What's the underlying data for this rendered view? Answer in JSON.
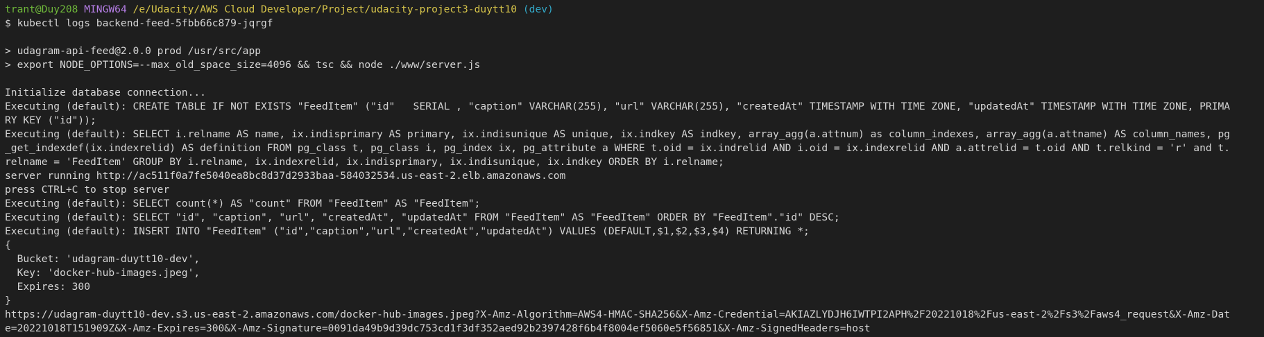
{
  "prompt": {
    "user_host": "trant@Duy208",
    "shell": "MINGW64",
    "path": "/e/Udacity/AWS Cloud Developer/Project/udacity-project3-duytt10",
    "branch": "(dev)"
  },
  "command": "$ kubectl logs backend-feed-5fbb66c879-jqrgf",
  "output_lines": [
    "",
    "> udagram-api-feed@2.0.0 prod /usr/src/app",
    "> export NODE_OPTIONS=--max_old_space_size=4096 && tsc && node ./www/server.js",
    "",
    "Initialize database connection...",
    "Executing (default): CREATE TABLE IF NOT EXISTS \"FeedItem\" (\"id\"   SERIAL , \"caption\" VARCHAR(255), \"url\" VARCHAR(255), \"createdAt\" TIMESTAMP WITH TIME ZONE, \"updatedAt\" TIMESTAMP WITH TIME ZONE, PRIMA",
    "RY KEY (\"id\"));",
    "Executing (default): SELECT i.relname AS name, ix.indisprimary AS primary, ix.indisunique AS unique, ix.indkey AS indkey, array_agg(a.attnum) as column_indexes, array_agg(a.attname) AS column_names, pg",
    "_get_indexdef(ix.indexrelid) AS definition FROM pg_class t, pg_class i, pg_index ix, pg_attribute a WHERE t.oid = ix.indrelid AND i.oid = ix.indexrelid AND a.attrelid = t.oid AND t.relkind = 'r' and t.",
    "relname = 'FeedItem' GROUP BY i.relname, ix.indexrelid, ix.indisprimary, ix.indisunique, ix.indkey ORDER BY i.relname;",
    "server running http://ac511f0a7fe5040ea8bc8d37d2933baa-584032534.us-east-2.elb.amazonaws.com",
    "press CTRL+C to stop server",
    "Executing (default): SELECT count(*) AS \"count\" FROM \"FeedItem\" AS \"FeedItem\";",
    "Executing (default): SELECT \"id\", \"caption\", \"url\", \"createdAt\", \"updatedAt\" FROM \"FeedItem\" AS \"FeedItem\" ORDER BY \"FeedItem\".\"id\" DESC;",
    "Executing (default): INSERT INTO \"FeedItem\" (\"id\",\"caption\",\"url\",\"createdAt\",\"updatedAt\") VALUES (DEFAULT,$1,$2,$3,$4) RETURNING *;",
    "{",
    "  Bucket: 'udagram-duytt10-dev',",
    "  Key: 'docker-hub-images.jpeg',",
    "  Expires: 300",
    "}",
    "https://udagram-duytt10-dev.s3.us-east-2.amazonaws.com/docker-hub-images.jpeg?X-Amz-Algorithm=AWS4-HMAC-SHA256&X-Amz-Credential=AKIAZLYDJH6IWTPI2APH%2F20221018%2Fus-east-2%2Fs3%2Faws4_request&X-Amz-Dat",
    "e=20221018T151909Z&X-Amz-Expires=300&X-Amz-Signature=0091da49b9d39dc753cd1f3df352aed92b2397428f6b4f8004ef5060e5f56851&X-Amz-SignedHeaders=host"
  ],
  "colors": {
    "background": "#1e1e1e",
    "text": "#d4d4d4",
    "user_host": "#6fb83a",
    "shell": "#b67ee6",
    "path": "#d6c44a",
    "branch": "#33a8c7"
  }
}
